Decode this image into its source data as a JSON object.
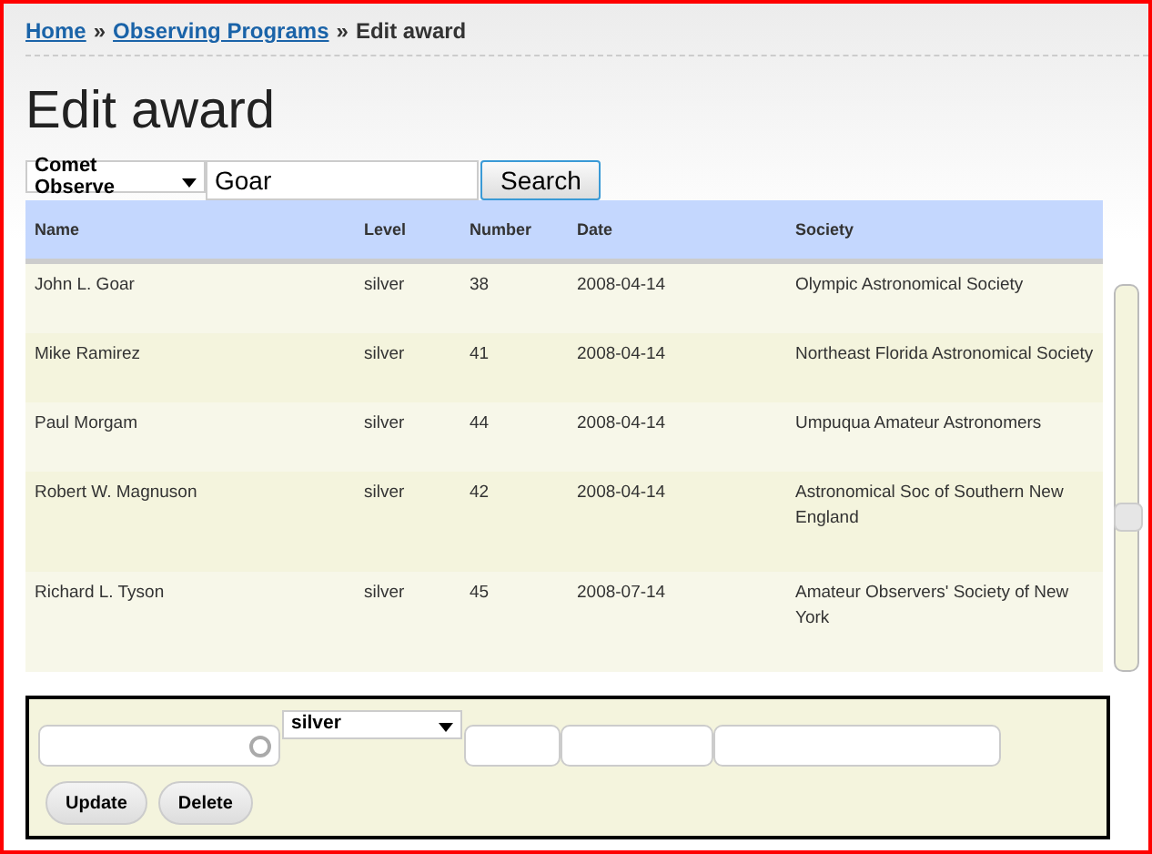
{
  "breadcrumbs": [
    {
      "label": "Home",
      "kind": "link"
    },
    {
      "label": "Observing Programs",
      "kind": "link"
    },
    {
      "label": "Edit award",
      "kind": "current"
    }
  ],
  "separator": "»",
  "title": "Edit award",
  "search": {
    "program": "Comet Observe",
    "query": "Goar",
    "button": "Search"
  },
  "table": {
    "columns": [
      "Name",
      "Level",
      "Number",
      "Date",
      "Society"
    ],
    "rows": [
      {
        "cells": [
          "John L. Goar",
          "silver",
          "38",
          "2008-04-14",
          "Olympic Astronomical Society"
        ]
      },
      {
        "cells": [
          "Mike Ramirez",
          "silver",
          "41",
          "2008-04-14",
          "Northeast Florida Astronomical Society"
        ]
      },
      {
        "cells": [
          "Paul Morgam",
          "silver",
          "44",
          "2008-04-14",
          "Umpuqua Amateur Astronomers"
        ]
      },
      {
        "cells": [
          "Robert W. Magnuson",
          "silver",
          "42",
          "2008-04-14",
          "Astronomical Soc of Southern New England"
        ]
      },
      {
        "cells": [
          "Richard L. Tyson",
          "silver",
          "45",
          "2008-07-14",
          "Amateur Observers' Society of New York"
        ]
      }
    ]
  },
  "form": {
    "level": "silver",
    "buttons": [
      "Update",
      "Delete"
    ]
  }
}
